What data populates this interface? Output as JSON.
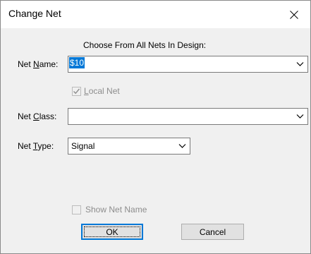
{
  "dialog": {
    "title": "Change Net",
    "close_icon": "close-icon"
  },
  "header_text": "Choose From All Nets In Design:",
  "net_name": {
    "label_pre": "Net ",
    "label_access": "N",
    "label_post": "ame:",
    "value": "$10"
  },
  "local_net": {
    "label_access": "L",
    "label_post": "ocal Net",
    "checked": true,
    "enabled": false
  },
  "net_class": {
    "label_pre": "Net ",
    "label_access": "C",
    "label_post": "lass:",
    "value": ""
  },
  "net_type": {
    "label_pre": "Net ",
    "label_access": "T",
    "label_post": "ype:",
    "value": "Signal"
  },
  "show_net_name": {
    "label": "Show Net Name",
    "checked": false,
    "enabled": false
  },
  "buttons": {
    "ok": "OK",
    "cancel": "Cancel"
  },
  "colors": {
    "selection": "#0078d7",
    "disabled_text": "#8d8d8d",
    "dialog_bg": "#f0f0f0"
  }
}
